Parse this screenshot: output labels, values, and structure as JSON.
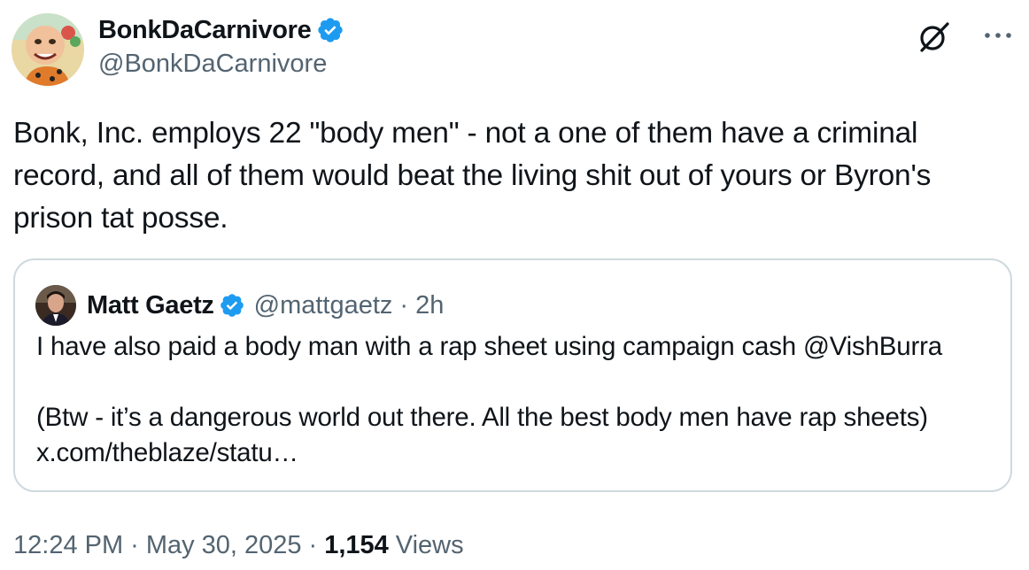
{
  "author": {
    "display_name": "BonkDaCarnivore",
    "handle": "@BonkDaCarnivore",
    "verified": true,
    "badge_color": "#1d9bf0"
  },
  "header_actions": {
    "grok_icon": "grok-icon",
    "more_icon": "more-icon"
  },
  "tweet": {
    "text": "Bonk, Inc. employs 22 \"body men\" - not a one of them have a criminal record, and all of them would beat the living shit out of yours or Byron's prison tat posse."
  },
  "quoted": {
    "display_name": "Matt Gaetz",
    "handle": "@mattgaetz",
    "separator": "·",
    "time": "2h",
    "verified": true,
    "text": "I have also paid a body man with a rap sheet using campaign cash @VishBurra\n\n(Btw - it’s a dangerous world out there. All the best body men have rap sheets)\nx.com/theblaze/statu…"
  },
  "meta": {
    "time": "12:24 PM",
    "separator": "·",
    "date": "May 30, 2025",
    "views_count": "1,154",
    "views_label": "Views"
  },
  "colors": {
    "text": "#0f1419",
    "secondary": "#536471",
    "border": "#cfd9de",
    "verified": "#1d9bf0"
  }
}
